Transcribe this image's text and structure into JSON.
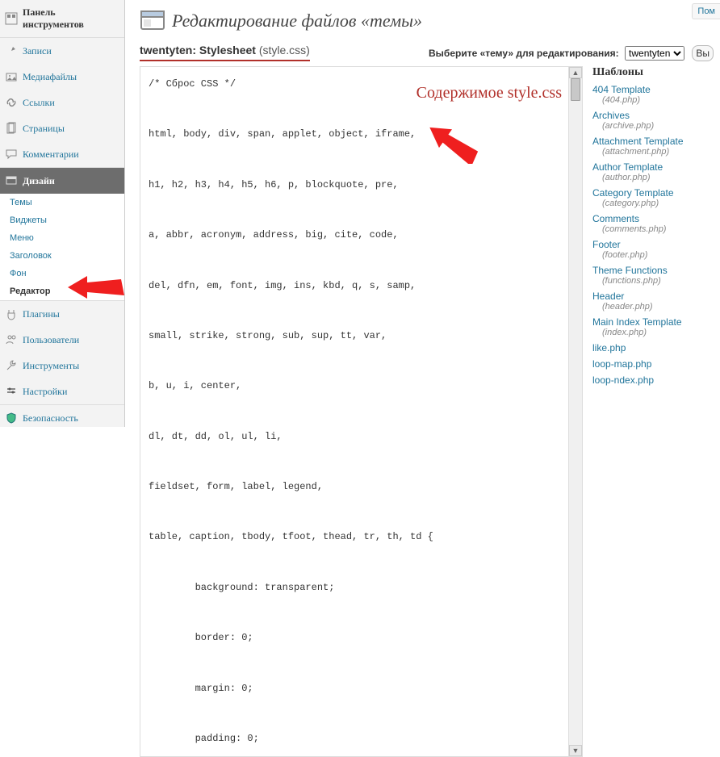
{
  "help_label": "Пом",
  "sidebar": {
    "dashboard": "Панель инструментов",
    "posts": "Записи",
    "media": "Медиафайлы",
    "links": "Ссылки",
    "pages": "Страницы",
    "comments": "Комментарии",
    "appearance": "Дизайн",
    "appearance_sub": {
      "themes": "Темы",
      "widgets": "Виджеты",
      "menus": "Меню",
      "header": "Заголовок",
      "background": "Фон",
      "editor": "Редактор"
    },
    "plugins": "Плагины",
    "users": "Пользователи",
    "tools": "Инструменты",
    "settings": "Настройки",
    "security": "Безопасность"
  },
  "page": {
    "title": "Редактирование файлов «темы»",
    "filelabel_strong": "twentyten: Stylesheet",
    "filelabel_fn": "(style.css)",
    "select_label": "Выберите «тему» для редактирования:",
    "select_value": "twentyten",
    "select_btn": "Вы",
    "code": "/* Сброс CSS */\n\nhtml, body, div, span, applet, object, iframe,\n\nh1, h2, h3, h4, h5, h6, p, blockquote, pre,\n\na, abbr, acronym, address, big, cite, code,\n\ndel, dfn, em, font, img, ins, kbd, q, s, samp,\n\nsmall, strike, strong, sub, sup, tt, var,\n\nb, u, i, center,\n\ndl, dt, dd, ol, ul, li,\n\nfieldset, form, label, legend,\n\ntable, caption, tbody, tfoot, thead, tr, th, td {\n\n        background: transparent;\n\n        border: 0;\n\n        margin: 0;\n\n        padding: 0;",
    "annotation": "Содержимое\nstyle.css"
  },
  "files": {
    "heading": "Шаблоны",
    "list": [
      {
        "label": "404 Template",
        "fn": "(404.php)"
      },
      {
        "label": "Archives",
        "fn": "(archive.php)"
      },
      {
        "label": "Attachment Template",
        "fn": "(attachment.php)"
      },
      {
        "label": "Author Template",
        "fn": "(author.php)"
      },
      {
        "label": "Category Template",
        "fn": "(category.php)"
      },
      {
        "label": "Comments",
        "fn": "(comments.php)"
      },
      {
        "label": "Footer",
        "fn": "(footer.php)"
      },
      {
        "label": "Theme Functions",
        "fn": "(functions.php)"
      },
      {
        "label": "Header",
        "fn": "(header.php)"
      },
      {
        "label": "Main Index Template",
        "fn": "(index.php)"
      },
      {
        "label": "like.php",
        "fn": ""
      },
      {
        "label": "loop-map.php",
        "fn": ""
      },
      {
        "label": "loop-ndex.php",
        "fn": ""
      }
    ]
  }
}
